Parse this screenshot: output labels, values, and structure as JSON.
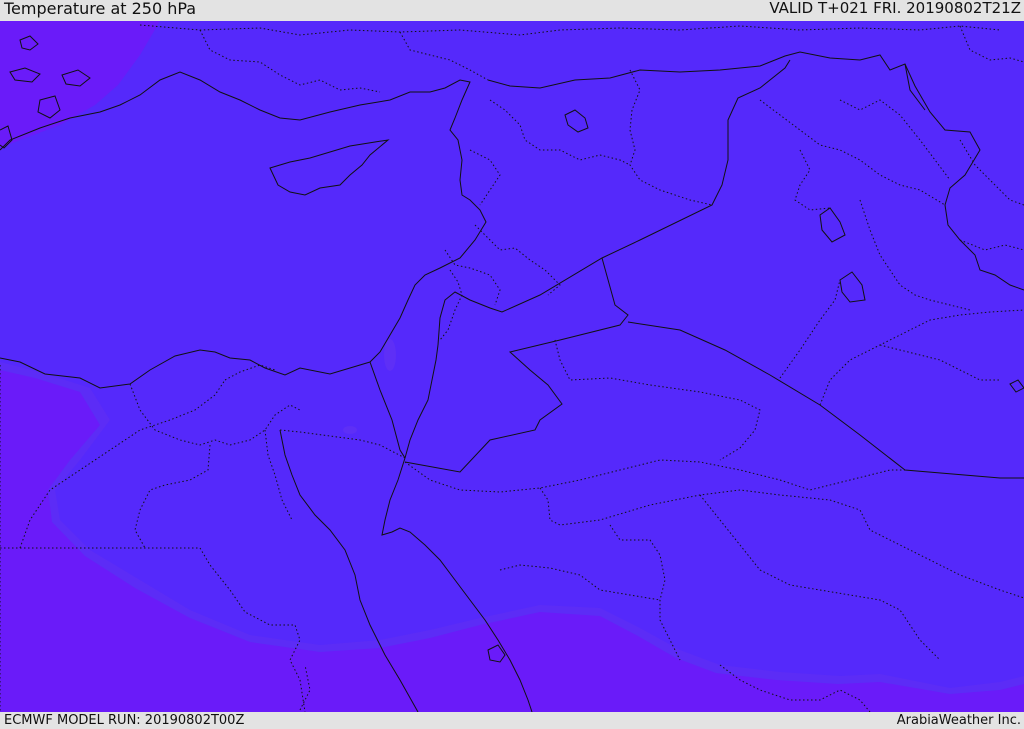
{
  "header": {
    "title": "Temperature at 250 hPa",
    "valid": "VALID T+021 FRI. 20190802T21Z"
  },
  "footer": {
    "model_run": "ECMWF MODEL RUN: 20190802T00Z",
    "credit": "ArabiaWeather Inc."
  },
  "map": {
    "colors": {
      "main_field": "#5529fb",
      "cold_field": "#6a1bf9",
      "light_band": "#5c2cf6",
      "border": "#111111"
    }
  }
}
